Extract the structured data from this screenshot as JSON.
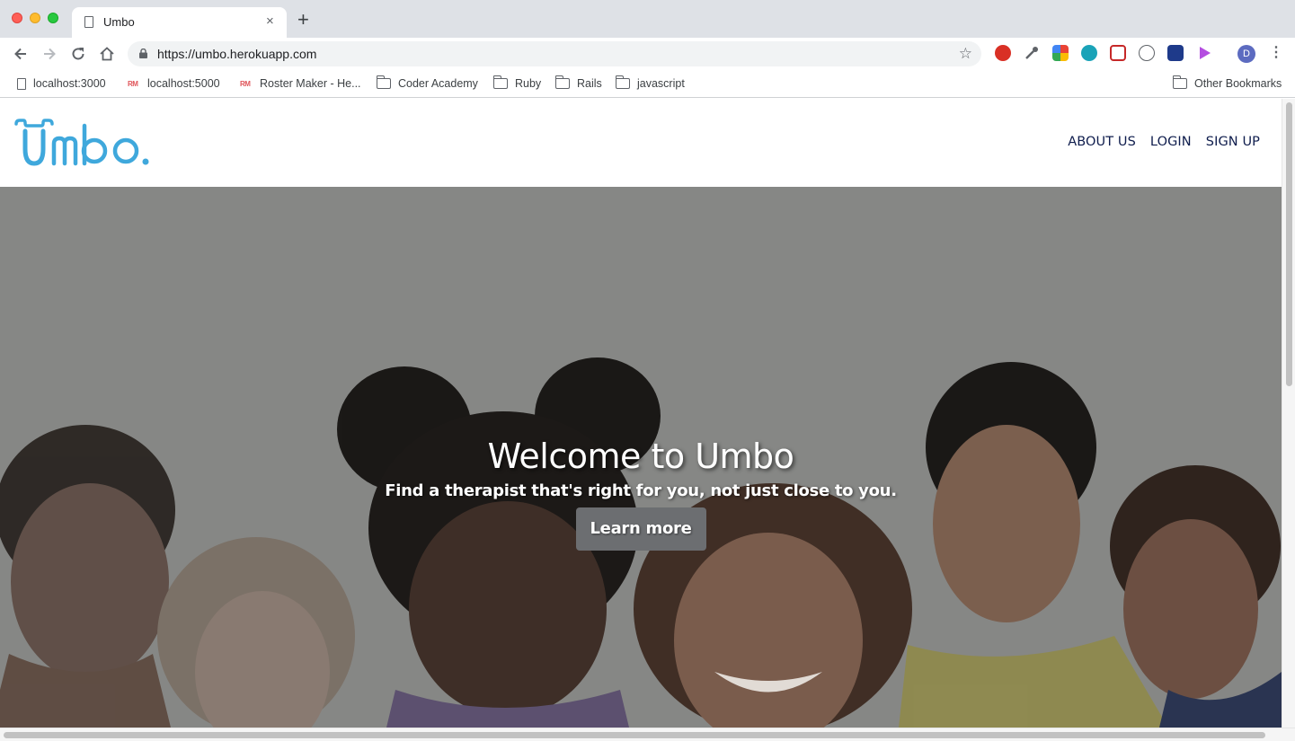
{
  "browser": {
    "tab": {
      "title": "Umbo",
      "close_glyph": "×",
      "favicon": "page-icon"
    },
    "new_tab_glyph": "+",
    "url": "https://umbo.herokuapp.com",
    "profile_initial": "D",
    "bookmarks": [
      {
        "label": "localhost:3000",
        "icon": "page-icon"
      },
      {
        "label": "localhost:5000",
        "icon": "rm-icon"
      },
      {
        "label": "Roster Maker - He...",
        "icon": "rm-icon"
      },
      {
        "label": "Coder Academy",
        "icon": "folder-icon"
      },
      {
        "label": "Ruby",
        "icon": "folder-icon"
      },
      {
        "label": "Rails",
        "icon": "folder-icon"
      },
      {
        "label": "javascript",
        "icon": "folder-icon"
      }
    ],
    "other_bookmarks": "Other Bookmarks",
    "rm_badge": "RM"
  },
  "site": {
    "logo_alt": "Umbo.",
    "nav": [
      {
        "label": "ABOUT US"
      },
      {
        "label": "LOGIN"
      },
      {
        "label": "SIGN UP"
      }
    ]
  },
  "hero": {
    "title": "Welcome to Umbo",
    "subtitle": "Find a therapist that's right for you, not just close to you.",
    "cta": "Learn more"
  },
  "colors": {
    "logo": "#3fa8dc",
    "nav_text": "#0f1d4d",
    "hero_overlay": "#858684",
    "cta_bg": "#6c6e71"
  }
}
